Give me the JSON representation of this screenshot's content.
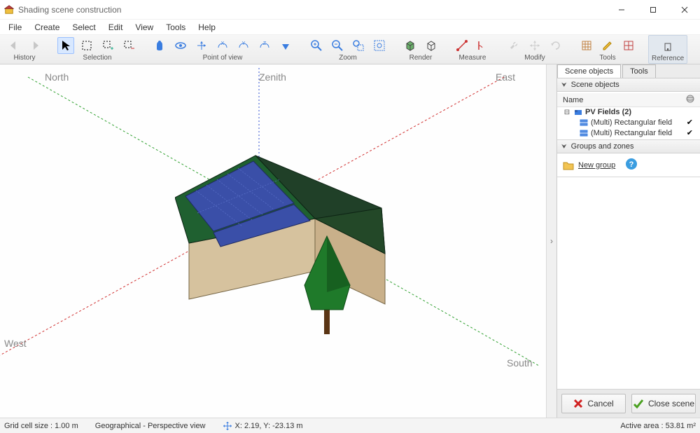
{
  "window": {
    "title": "Shading scene construction"
  },
  "menubar": {
    "items": [
      "File",
      "Create",
      "Select",
      "Edit",
      "View",
      "Tools",
      "Help"
    ]
  },
  "toolbar": {
    "groups": {
      "history_label": "History",
      "selection_label": "Selection",
      "pov_label": "Point of view",
      "zoom_label": "Zoom",
      "render_label": "Render",
      "measure_label": "Measure",
      "modify_label": "Modify",
      "tools_label": "Tools",
      "reference_label": "Reference"
    }
  },
  "viewport": {
    "labels": {
      "north": "North",
      "zenith": "Zenith",
      "east": "East",
      "west": "West",
      "south": "South"
    }
  },
  "sidepanel": {
    "tabs": [
      "Scene objects",
      "Tools"
    ],
    "scene_objects": {
      "header": "Scene objects",
      "name_col": "Name",
      "nodes": {
        "root": "PV Fields (2)",
        "child1": "(Multi) Rectangular field",
        "child2": "(Multi) Rectangular field"
      }
    },
    "groups_zones": {
      "header": "Groups and zones",
      "new_group": "New group"
    },
    "buttons": {
      "cancel": "Cancel",
      "close_scene": "Close scene"
    }
  },
  "statusbar": {
    "grid_cell": "Grid cell size :  1.00 m",
    "view_mode": "Geographical - Perspective view",
    "coords": "X: 2.19, Y: -23.13 m",
    "active_area": "Active area : 53.81 m²"
  }
}
